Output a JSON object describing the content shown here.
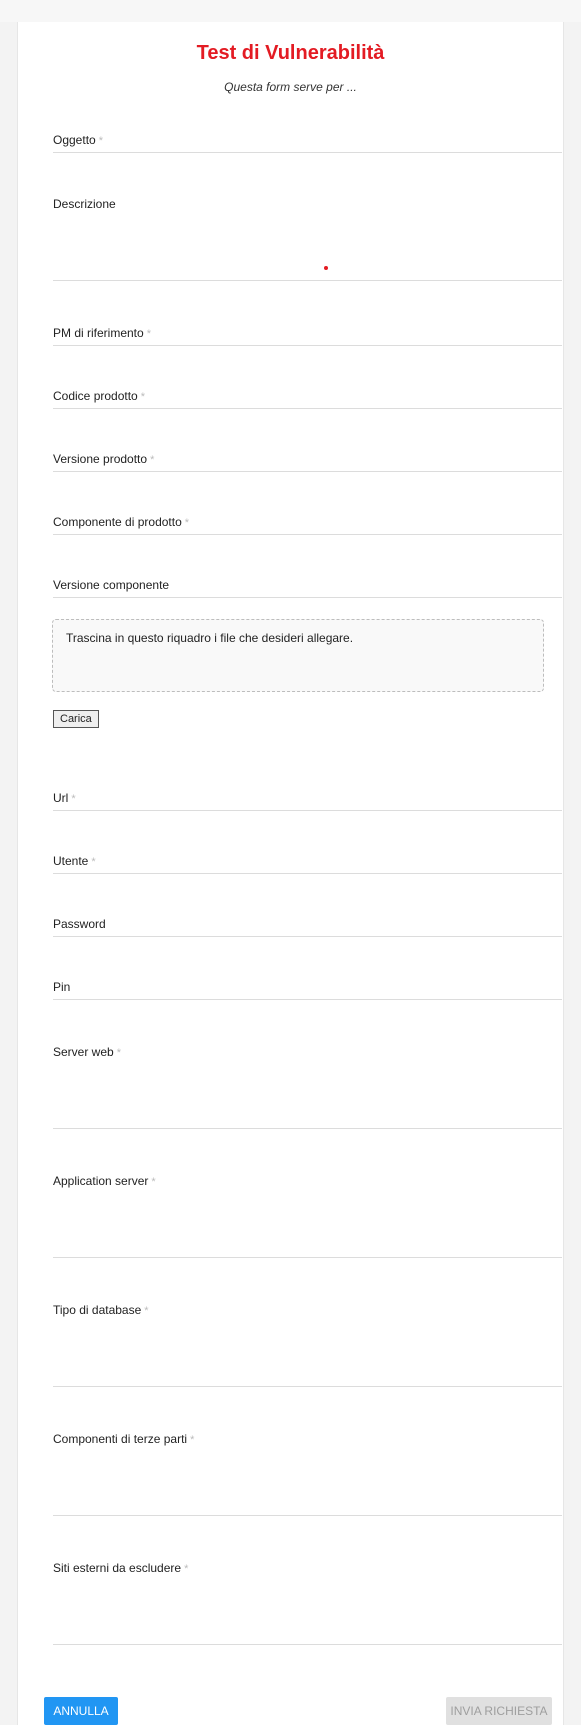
{
  "form": {
    "title": "Test di Vulnerabilità",
    "subtitle": "Questa form serve per ...",
    "required_mark": "*",
    "fields": {
      "oggetto": "Oggetto",
      "descrizione": "Descrizione",
      "pm": "PM di riferimento",
      "codice": "Codice prodotto",
      "versione_prodotto": "Versione prodotto",
      "componente": "Componente di prodotto",
      "versione_componente": "Versione componente",
      "url": "Url",
      "utente": "Utente",
      "password": "Password",
      "pin": "Pin",
      "server_web": "Server web",
      "application_server": "Application server",
      "tipo_database": "Tipo di database",
      "terze_parti": "Componenti di terze parti",
      "siti_esterni": "Siti esterni da escludere"
    },
    "dropzone_text": "Trascina in questo riquadro i file che desideri allegare.",
    "upload_label": "Carica",
    "cancel_label": "ANNULLA",
    "submit_label": "INVIA RICHIESTA"
  },
  "colors": {
    "title": "#e31b23",
    "primary_button": "#2196f3",
    "disabled_button": "#e0e0e0"
  }
}
